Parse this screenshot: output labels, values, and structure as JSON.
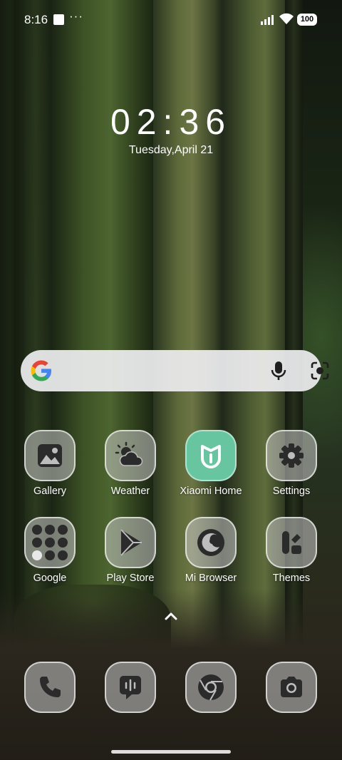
{
  "status_bar": {
    "time": "8:16",
    "overflow": "···",
    "battery": "100",
    "icons": [
      "notification-square-icon",
      "signal-icon",
      "wifi-icon",
      "battery-icon"
    ]
  },
  "clock": {
    "time": "02:36",
    "date": "Tuesday,April 21"
  },
  "search": {
    "icons": [
      "google-logo",
      "mic-icon",
      "lens-icon"
    ]
  },
  "apps": [
    {
      "label": "Gallery",
      "icon": "gallery-icon"
    },
    {
      "label": "Weather",
      "icon": "weather-icon"
    },
    {
      "label": "Xiaomi Home",
      "icon": "xiaomi-home-icon"
    },
    {
      "label": "Settings",
      "icon": "gear-icon"
    },
    {
      "label": "Google",
      "icon": "google-folder-icon"
    },
    {
      "label": "Play Store",
      "icon": "play-store-icon"
    },
    {
      "label": "Mi Browser",
      "icon": "browser-icon"
    },
    {
      "label": "Themes",
      "icon": "themes-icon"
    }
  ],
  "dock": [
    "phone-icon",
    "messages-icon",
    "chrome-icon",
    "camera-icon"
  ],
  "colors": {
    "xiaomi_home": "#67c5a0",
    "icon_glyph": "#2b2b2b",
    "search_bg": "#eeeef0"
  }
}
